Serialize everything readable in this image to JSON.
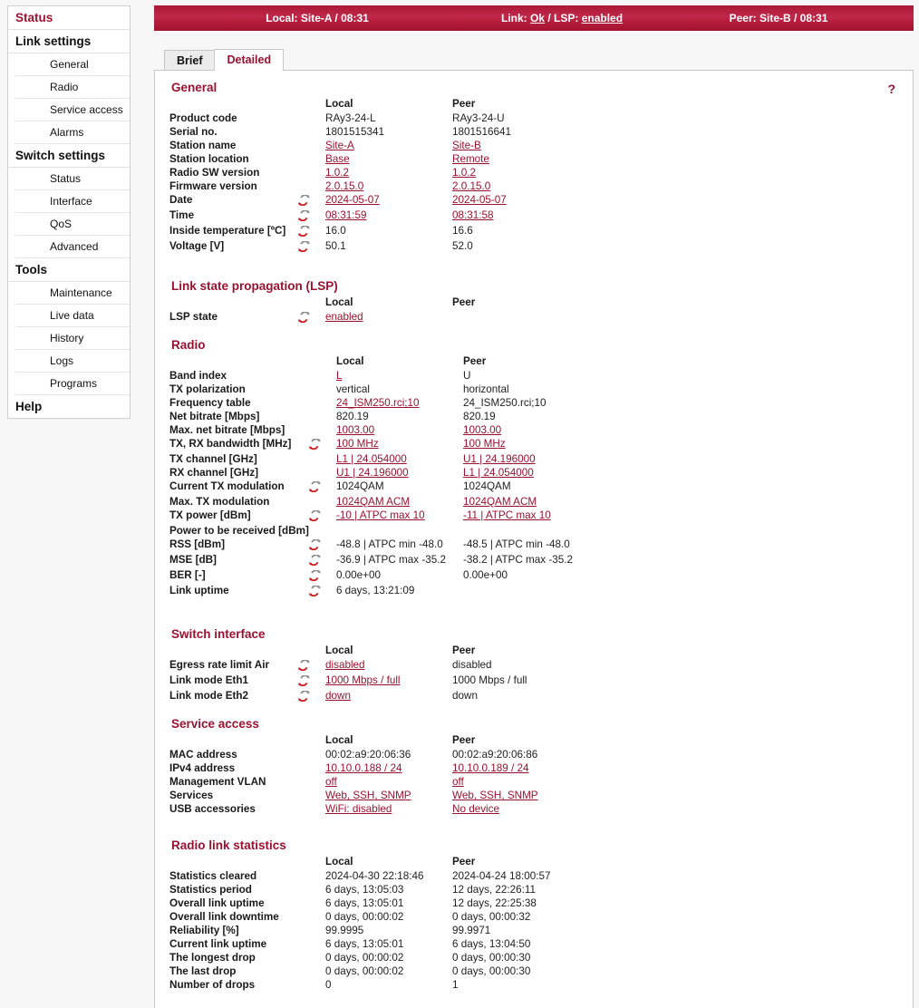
{
  "colors": {
    "accent": "#9b1231",
    "topbar_red": "#b71e3e",
    "panel_bg": "#ffffff",
    "page_bg": "#f7f7f7"
  },
  "sidebar": {
    "groups": [
      {
        "label": "Status",
        "active": true,
        "items": []
      },
      {
        "label": "Link settings",
        "active": false,
        "items": [
          "General",
          "Radio",
          "Service access",
          "Alarms"
        ]
      },
      {
        "label": "Switch settings",
        "active": false,
        "items": [
          "Status",
          "Interface",
          "QoS",
          "Advanced"
        ]
      },
      {
        "label": "Tools",
        "active": false,
        "items": [
          "Maintenance",
          "Live data",
          "History",
          "Logs",
          "Programs"
        ]
      },
      {
        "label": "Help",
        "active": false,
        "items": []
      }
    ]
  },
  "topbar": {
    "local_prefix": "Local:",
    "local_value": "Site-A / 08:31",
    "link_prefix": "Link:",
    "link_state": "Ok",
    "link_sep": "/ LSP:",
    "lsp_state": "enabled",
    "peer_prefix": "Peer:",
    "peer_value": "Site-B / 08:31"
  },
  "tabs": [
    {
      "label": "Brief",
      "active": false
    },
    {
      "label": "Detailed",
      "active": true
    }
  ],
  "help_icon": "?",
  "column_headers": {
    "local": "Local",
    "peer": "Peer"
  },
  "icons": {
    "refresh": "refresh-icon",
    "help": "help-icon"
  },
  "sections": [
    {
      "title": "General",
      "rows": [
        {
          "label": "Product code",
          "refresh": false,
          "local": "RAy3-24-L",
          "local_link": false,
          "peer": "RAy3-24-U",
          "peer_link": false
        },
        {
          "label": "Serial no.",
          "refresh": false,
          "local": "1801515341",
          "local_link": false,
          "peer": "1801516641",
          "peer_link": false
        },
        {
          "label": "Station name",
          "refresh": false,
          "local": "Site-A",
          "local_link": true,
          "peer": "Site-B",
          "peer_link": true
        },
        {
          "label": "Station location",
          "refresh": false,
          "local": "Base",
          "local_link": true,
          "peer": "Remote",
          "peer_link": true
        },
        {
          "label": "Radio SW version",
          "refresh": false,
          "local": "1.0.2",
          "local_link": true,
          "peer": "1.0.2",
          "peer_link": true
        },
        {
          "label": "Firmware version",
          "refresh": false,
          "local": "2.0.15.0",
          "local_link": true,
          "peer": "2.0.15.0",
          "peer_link": true
        },
        {
          "label": "Date",
          "refresh": true,
          "local": "2024-05-07",
          "local_link": true,
          "peer": "2024-05-07",
          "peer_link": true
        },
        {
          "label": "Time",
          "refresh": true,
          "local": "08:31:59",
          "local_link": true,
          "peer": "08:31:58",
          "peer_link": true
        },
        {
          "label": "Inside temperature [ºC]",
          "refresh": true,
          "local": "16.0",
          "local_link": false,
          "peer": "16.6",
          "peer_link": false
        },
        {
          "label": "Voltage [V]",
          "refresh": true,
          "local": "50.1",
          "local_link": false,
          "peer": "52.0",
          "peer_link": false
        }
      ]
    },
    {
      "title": "Link state propagation (LSP)",
      "rows": [
        {
          "label": "LSP state",
          "refresh": true,
          "local": "enabled",
          "local_link": true,
          "peer": "",
          "peer_link": false
        }
      ]
    },
    {
      "title": "Radio",
      "rows": [
        {
          "label": "Band index",
          "refresh": false,
          "local": "L",
          "local_link": true,
          "peer": "U",
          "peer_link": false
        },
        {
          "label": "TX polarization",
          "refresh": false,
          "local": "vertical",
          "local_link": false,
          "peer": "horizontal",
          "peer_link": false
        },
        {
          "label": "Frequency table",
          "refresh": false,
          "local": "24_ISM250.rci;10",
          "local_link": true,
          "peer": "24_ISM250.rci;10",
          "peer_link": false
        },
        {
          "label": "Net bitrate [Mbps]",
          "refresh": false,
          "local": "820.19",
          "local_link": false,
          "peer": "820.19",
          "peer_link": false
        },
        {
          "label": "Max. net bitrate [Mbps]",
          "refresh": false,
          "local": "1003.00",
          "local_link": true,
          "peer": "1003.00",
          "peer_link": true
        },
        {
          "label": "TX, RX bandwidth [MHz]",
          "refresh": true,
          "local": "100 MHz",
          "local_link": true,
          "peer": "100 MHz",
          "peer_link": true
        },
        {
          "label": "TX channel [GHz]",
          "refresh": false,
          "local": "L1 | 24.054000",
          "local_link": true,
          "peer": "U1 | 24.196000",
          "peer_link": true
        },
        {
          "label": "RX channel [GHz]",
          "refresh": false,
          "local": "U1 | 24.196000",
          "local_link": true,
          "peer": "L1 | 24.054000",
          "peer_link": true
        },
        {
          "label": "Current TX modulation",
          "refresh": true,
          "local": "1024QAM",
          "local_link": false,
          "peer": "1024QAM",
          "peer_link": false
        },
        {
          "label": "Max. TX modulation",
          "refresh": false,
          "local": "1024QAM ACM",
          "local_link": true,
          "peer": "1024QAM ACM",
          "peer_link": true
        },
        {
          "label": "TX power [dBm]",
          "refresh": true,
          "local": "-10 | ATPC max 10",
          "local_link": true,
          "peer": "-11 | ATPC max 10",
          "peer_link": true
        },
        {
          "label": "Power to be received [dBm]",
          "refresh": false,
          "local": "",
          "local_link": false,
          "peer": "",
          "peer_link": false
        },
        {
          "label": "RSS [dBm]",
          "refresh": true,
          "local": "-48.8 | ATPC min -48.0",
          "local_link": false,
          "peer": "-48.5 | ATPC min -48.0",
          "peer_link": false
        },
        {
          "label": "MSE [dB]",
          "refresh": true,
          "local": "-36.9 | ATPC max -35.2",
          "local_link": false,
          "peer": "-38.2 | ATPC max -35.2",
          "peer_link": false
        },
        {
          "label": "BER [-]",
          "refresh": true,
          "local": "0.00e+00",
          "local_link": false,
          "peer": "0.00e+00",
          "peer_link": false
        },
        {
          "label": "Link uptime",
          "refresh": true,
          "local": "6 days, 13:21:09",
          "local_link": false,
          "peer": "",
          "peer_link": false
        }
      ]
    },
    {
      "title": "Switch interface",
      "rows": [
        {
          "label": "Egress rate limit Air",
          "refresh": true,
          "local": "disabled",
          "local_link": true,
          "peer": "disabled",
          "peer_link": false
        },
        {
          "label": "Link mode Eth1",
          "refresh": true,
          "local": "1000 Mbps / full",
          "local_link": true,
          "peer": "1000 Mbps / full",
          "peer_link": false
        },
        {
          "label": "Link mode Eth2",
          "refresh": true,
          "local": "down",
          "local_link": true,
          "peer": "down",
          "peer_link": false
        }
      ]
    },
    {
      "title": "Service access",
      "rows": [
        {
          "label": "MAC address",
          "refresh": false,
          "local": "00:02:a9:20:06:36",
          "local_link": false,
          "peer": "00:02:a9:20:06:86",
          "peer_link": false
        },
        {
          "label": "IPv4 address",
          "refresh": false,
          "local": "10.10.0.188 / 24",
          "local_link": true,
          "peer": "10.10.0.189 / 24",
          "peer_link": true
        },
        {
          "label": "Management VLAN",
          "refresh": false,
          "local": "off",
          "local_link": true,
          "peer": "off",
          "peer_link": true
        },
        {
          "label": "Services",
          "refresh": false,
          "local": "Web, SSH, SNMP",
          "local_link": true,
          "peer": "Web, SSH, SNMP",
          "peer_link": true
        },
        {
          "label": "USB accessories",
          "refresh": false,
          "local": "WiFi: disabled",
          "local_link": true,
          "peer": "No device",
          "peer_link": true
        }
      ]
    },
    {
      "title": "Radio link statistics",
      "rows": [
        {
          "label": "Statistics cleared",
          "refresh": false,
          "local": "2024-04-30 22:18:46",
          "local_link": false,
          "peer": "2024-04-24 18:00:57",
          "peer_link": false
        },
        {
          "label": "Statistics period",
          "refresh": false,
          "local": "6 days, 13:05:03",
          "local_link": false,
          "peer": "12 days, 22:26:11",
          "peer_link": false
        },
        {
          "label": "Overall link uptime",
          "refresh": false,
          "local": "6 days, 13:05:01",
          "local_link": false,
          "peer": "12 days, 22:25:38",
          "peer_link": false
        },
        {
          "label": "Overall link downtime",
          "refresh": false,
          "local": "0 days, 00:00:02",
          "local_link": false,
          "peer": "0 days, 00:00:32",
          "peer_link": false
        },
        {
          "label": "Reliability [%]",
          "refresh": false,
          "local": "99.9995",
          "local_link": false,
          "peer": "99.9971",
          "peer_link": false
        },
        {
          "label": "Current link uptime",
          "refresh": false,
          "local": "6 days, 13:05:01",
          "local_link": false,
          "peer": "6 days, 13:04:50",
          "peer_link": false
        },
        {
          "label": "The longest drop",
          "refresh": false,
          "local": "0 days, 00:00:02",
          "local_link": false,
          "peer": "0 days, 00:00:30",
          "peer_link": false
        },
        {
          "label": "The last drop",
          "refresh": false,
          "local": "0 days, 00:00:02",
          "local_link": false,
          "peer": "0 days, 00:00:30",
          "peer_link": false
        },
        {
          "label": "Number of drops",
          "refresh": false,
          "local": "0",
          "local_link": false,
          "peer": "1",
          "peer_link": false
        }
      ]
    }
  ]
}
